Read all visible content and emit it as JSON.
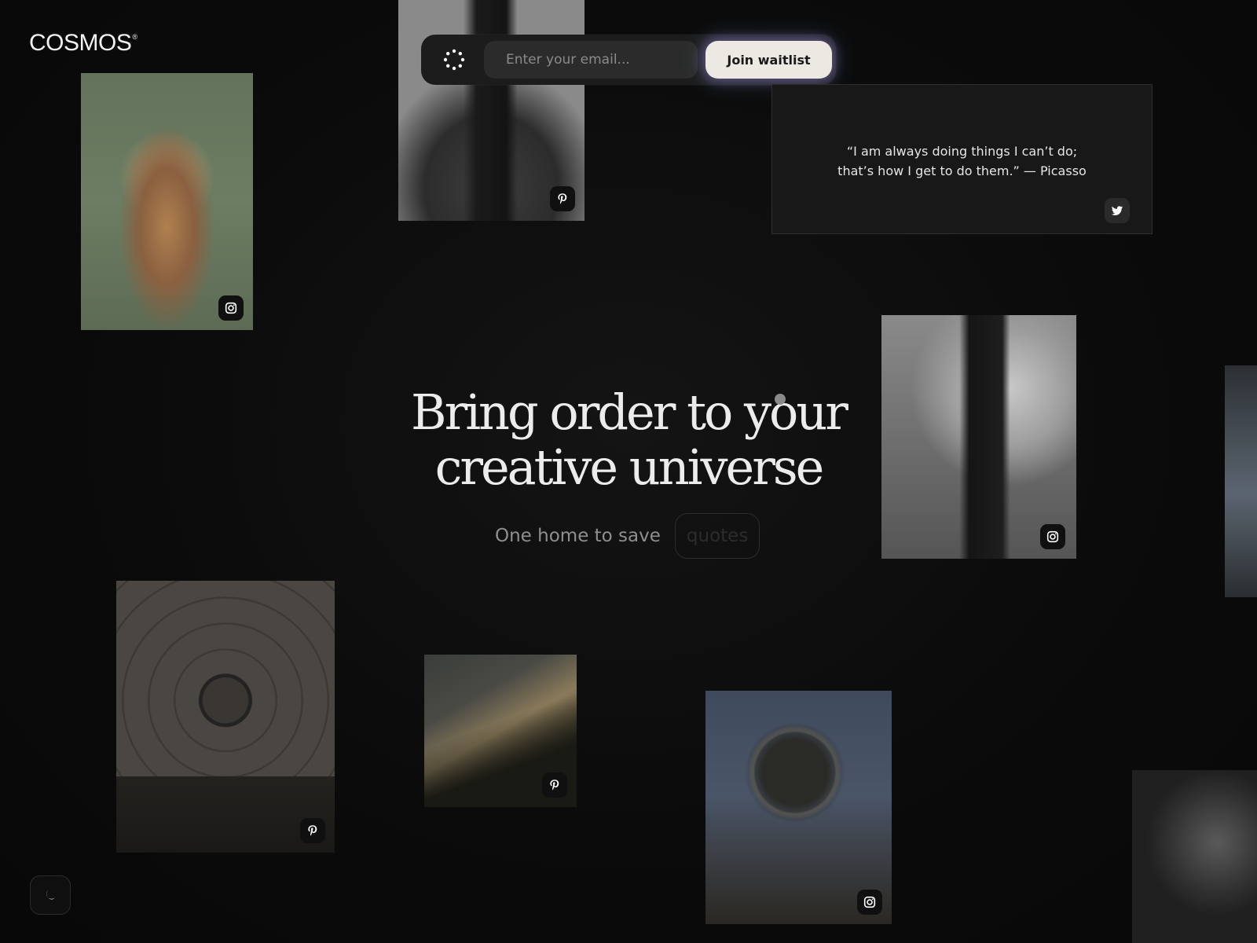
{
  "brand": {
    "name": "COSMOS",
    "mark": "®"
  },
  "waitlist": {
    "email_placeholder": "Enter your email...",
    "email_value": "",
    "button_label": "Join waitlist",
    "spinner_icon": "spinner-icon"
  },
  "quote": {
    "line1": "“I am always doing things I can’t do;",
    "line2": "that’s how I get to do them.” — Picasso",
    "source_icon": "twitter-icon"
  },
  "hero": {
    "line1": "Bring order to your",
    "line2": "creative universe",
    "subline_lead": "One home to save",
    "rotating_word": "quotes"
  },
  "cards": [
    {
      "name": "photo-card-figure-green",
      "source_icon": "instagram-icon"
    },
    {
      "name": "photo-card-hair-clips",
      "source_icon": "pinterest-icon"
    },
    {
      "name": "photo-card-draped-figure",
      "source_icon": "instagram-icon"
    },
    {
      "name": "photo-card-balloon-interior",
      "source_icon": "pinterest-icon"
    },
    {
      "name": "photo-card-hillside",
      "source_icon": "pinterest-icon"
    },
    {
      "name": "photo-card-dandelion-lights",
      "source_icon": "instagram-icon"
    }
  ],
  "theme_toggle": {
    "icon": "moon-icon"
  },
  "colors": {
    "background": "#0b0b0b",
    "button": "#ece9e3",
    "button_glow": "#be96ff"
  }
}
